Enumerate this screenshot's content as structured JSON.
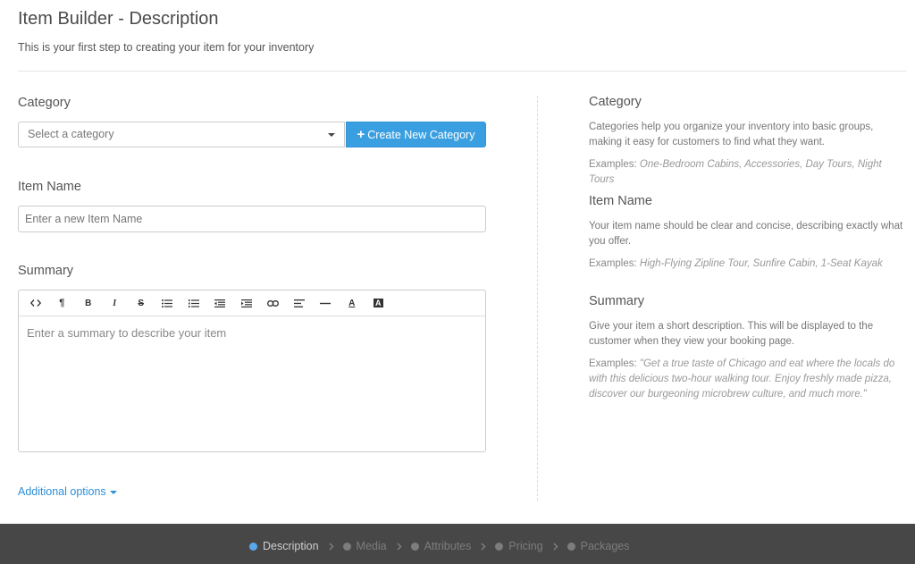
{
  "page": {
    "title": "Item Builder - Description",
    "subtitle": "This is your first step to creating your item for your inventory"
  },
  "form": {
    "category": {
      "label": "Category",
      "select_placeholder": "Select a category",
      "create_button_label": "Create New Category"
    },
    "item_name": {
      "label": "Item Name",
      "placeholder": "Enter a new Item Name"
    },
    "summary": {
      "label": "Summary",
      "placeholder": "Enter a summary to describe your item",
      "toolbar": [
        {
          "name": "code-view-icon",
          "glyph": "<>"
        },
        {
          "name": "paragraph-icon",
          "glyph": "¶"
        },
        {
          "name": "bold-icon",
          "glyph": "B"
        },
        {
          "name": "italic-icon",
          "glyph": "I"
        },
        {
          "name": "strikethrough-icon",
          "glyph": "S"
        },
        {
          "name": "bullet-list-icon",
          "glyph": ""
        },
        {
          "name": "numbered-list-icon",
          "glyph": ""
        },
        {
          "name": "outdent-icon",
          "glyph": ""
        },
        {
          "name": "indent-icon",
          "glyph": ""
        },
        {
          "name": "link-icon",
          "glyph": ""
        },
        {
          "name": "align-icon",
          "glyph": ""
        },
        {
          "name": "horizontal-rule-icon",
          "glyph": ""
        },
        {
          "name": "font-color-icon",
          "glyph": "A"
        },
        {
          "name": "background-color-icon",
          "glyph": "A"
        }
      ]
    },
    "additional_options": "Additional options"
  },
  "help": {
    "category": {
      "title": "Category",
      "text": "Categories help you organize your inventory into basic groups, making it easy for customers to find what they want.",
      "examples_label": "Examples:",
      "examples": "One-Bedroom Cabins, Accessories, Day Tours, Night Tours"
    },
    "item_name": {
      "title": "Item Name",
      "text": "Your item name should be clear and concise, describing exactly what you offer.",
      "examples_label": "Examples:",
      "examples": "High-Flying Zipline Tour, Sunfire Cabin, 1-Seat Kayak"
    },
    "summary": {
      "title": "Summary",
      "text": "Give your item a short description. This will be displayed to the customer when they view your booking page.",
      "examples_label": "Examples:",
      "examples": "\"Get a true taste of Chicago and eat where the locals do with this delicious two-hour walking tour. Enjoy freshly made pizza, discover our burgeoning microbrew culture, and much more.\""
    }
  },
  "steps": [
    {
      "label": "Description",
      "active": true
    },
    {
      "label": "Media",
      "active": false
    },
    {
      "label": "Attributes",
      "active": false
    },
    {
      "label": "Pricing",
      "active": false
    },
    {
      "label": "Packages",
      "active": false
    }
  ],
  "colors": {
    "accent": "#3a9fe0",
    "link": "#2d8fd5",
    "footer": "#474747",
    "active_step_dot": "#59a8ee"
  }
}
